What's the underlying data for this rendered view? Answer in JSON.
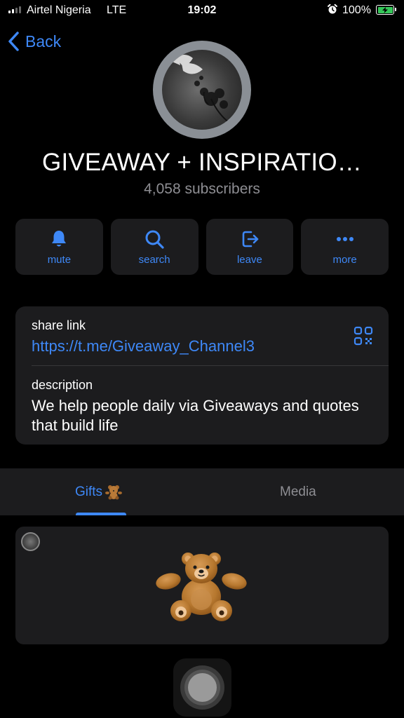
{
  "status_bar": {
    "carrier": "Airtel Nigeria",
    "network": "LTE",
    "time": "19:02",
    "battery": "100%",
    "alarm_icon": "alarm-clock-icon",
    "battery_color": "#35c759"
  },
  "header": {
    "back_label": "Back",
    "title": "GIVEAWAY + INSPIRATIO…",
    "subscribers": "4,058 subscribers"
  },
  "actions": [
    {
      "label": "mute",
      "icon": "bell-icon"
    },
    {
      "label": "search",
      "icon": "search-icon"
    },
    {
      "label": "leave",
      "icon": "leave-icon"
    },
    {
      "label": "more",
      "icon": "more-icon"
    }
  ],
  "info": {
    "share_label": "share link",
    "share_link": "https://t.me/Giveaway_Channel3",
    "qr_icon": "qr-code-icon",
    "description_label": "description",
    "description": "We help people daily via Giveaways and quotes that build life"
  },
  "tabs": [
    {
      "label": "Gifts",
      "active": true,
      "icon": "teddy-bear-icon"
    },
    {
      "label": "Media",
      "active": false
    }
  ],
  "gift": {
    "icon": "teddy-bear-icon"
  },
  "colors": {
    "accent": "#3e88f7",
    "card": "#1c1c1e",
    "background": "#000000",
    "secondary_text": "#8e8e93"
  }
}
